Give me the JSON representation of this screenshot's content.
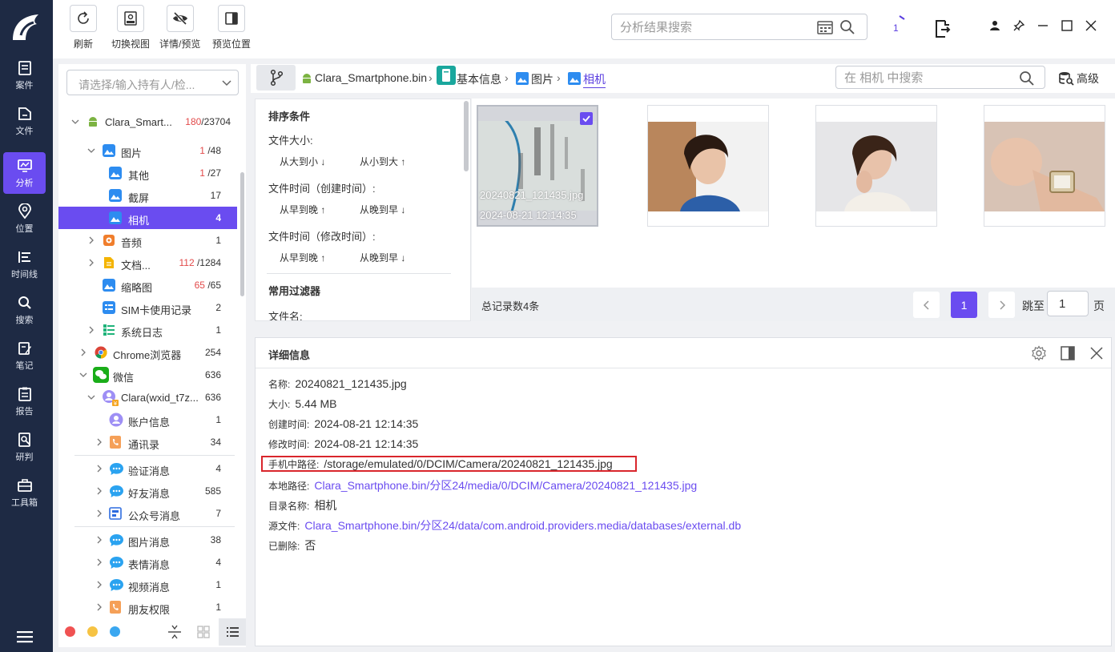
{
  "nav": {
    "items": [
      {
        "label": "案件",
        "icon": "case-icon"
      },
      {
        "label": "文件",
        "icon": "folder-icon"
      },
      {
        "label": "分析",
        "icon": "analysis-icon"
      },
      {
        "label": "位置",
        "icon": "location-icon"
      },
      {
        "label": "时间线",
        "icon": "timeline-icon"
      },
      {
        "label": "搜索",
        "icon": "search-icon"
      },
      {
        "label": "笔记",
        "icon": "note-icon"
      },
      {
        "label": "报告",
        "icon": "report-icon"
      },
      {
        "label": "研判",
        "icon": "investigate-icon"
      },
      {
        "label": "工具箱",
        "icon": "toolbox-icon"
      }
    ],
    "active_index": 2
  },
  "toolbar": {
    "refresh": "刷新",
    "switch_view": "切换视图",
    "detail_preview": "详情/预览",
    "preview_position": "预览位置",
    "search_placeholder": "分析结果搜索",
    "task_count": "1"
  },
  "tree": {
    "select_placeholder": "请选择/输入持有人/检...",
    "rows": [
      {
        "label": "Clara_Smart...",
        "red": "180",
        "count": "/23704"
      },
      {
        "label": "图片",
        "red": "1",
        "count": "/48"
      },
      {
        "label": "其他",
        "red": "1",
        "count": "/27"
      },
      {
        "label": "截屏",
        "red": "",
        "count": "17"
      },
      {
        "label": "相机",
        "red": "",
        "count": "4"
      },
      {
        "label": "音频",
        "red": "",
        "count": "1"
      },
      {
        "label": "文档...",
        "red": "112",
        "count": "/1284"
      },
      {
        "label": "缩略图",
        "red": "65",
        "count": "/65"
      },
      {
        "label": "SIM卡使用记录",
        "red": "",
        "count": "2"
      },
      {
        "label": "系统日志",
        "red": "",
        "count": "1"
      },
      {
        "label": "Chrome浏览器",
        "red": "",
        "count": "254"
      },
      {
        "label": "微信",
        "red": "",
        "count": "636"
      },
      {
        "label": "Clara(wxid_t7z...",
        "red": "",
        "count": "636"
      },
      {
        "label": "账户信息",
        "red": "",
        "count": "1"
      },
      {
        "label": "通讯录",
        "red": "",
        "count": "34"
      },
      {
        "label": "验证消息",
        "red": "",
        "count": "4"
      },
      {
        "label": "好友消息",
        "red": "",
        "count": "585"
      },
      {
        "label": "公众号消息",
        "red": "",
        "count": "7"
      },
      {
        "label": "图片消息",
        "red": "",
        "count": "38"
      },
      {
        "label": "表情消息",
        "red": "",
        "count": "4"
      },
      {
        "label": "视频消息",
        "red": "",
        "count": "1"
      },
      {
        "label": "朋友权限",
        "red": "",
        "count": "1"
      }
    ]
  },
  "breadcrumb": {
    "items": [
      "Clara_Smartphone.bin",
      "基本信息",
      "图片",
      "相机"
    ],
    "search_placeholder": "在 相机 中搜索",
    "advanced": "高级"
  },
  "sort": {
    "title": "排序条件",
    "size_label": "文件大小:",
    "size_desc": "从大到小",
    "size_asc": "从小到大",
    "ctime_label": "文件时间（创建时间）:",
    "mtime_label": "文件时间（修改时间）:",
    "early_late": "从早到晚",
    "late_early": "从晚到早",
    "filter_title": "常用过滤器",
    "filename_label": "文件名:"
  },
  "gallery": {
    "selected_caption_name": "20240821_121435.jpg",
    "selected_caption_time": "2024-08-21 12:14:35",
    "total": "总记录数4条",
    "current_page": "1",
    "jump_label": "跳至",
    "jump_value": "1",
    "page_unit": "页"
  },
  "detail": {
    "title": "详细信息",
    "rows": [
      {
        "k": "名称:",
        "v": "20240821_121435.jpg"
      },
      {
        "k": "大小:",
        "v": "5.44 MB"
      },
      {
        "k": "创建时间:",
        "v": "2024-08-21 12:14:35"
      },
      {
        "k": "修改时间:",
        "v": "2024-08-21 12:14:35"
      },
      {
        "k": "手机中路径:",
        "v": "/storage/emulated/0/DCIM/Camera/20240821_121435.jpg"
      },
      {
        "k": "本地路径:",
        "v": "Clara_Smartphone.bin/分区24/media/0/DCIM/Camera/20240821_121435.jpg"
      },
      {
        "k": "目录名称:",
        "v": "相机"
      },
      {
        "k": "源文件:",
        "v": "Clara_Smartphone.bin/分区24/data/com.android.providers.media/databases/external.db"
      },
      {
        "k": "已删除:",
        "v": "否"
      }
    ]
  },
  "colors": {
    "accent": "#6a4cf0",
    "nav_bg": "#1e2a44",
    "highlight_red": "#d9262c",
    "count_red": "#e24a4a"
  }
}
